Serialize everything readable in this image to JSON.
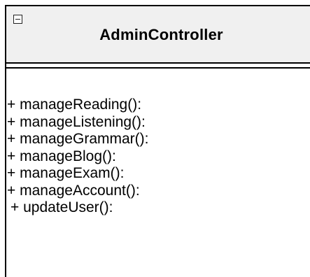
{
  "class": {
    "name": "AdminController",
    "collapse_icon": "minus-box-icon",
    "operations": [
      "+ manageReading():",
      "+ manageListening():",
      "+ manageGrammar():",
      "+ manageBlog():",
      "+ manageExam():",
      "+ manageAccount():",
      "+ updateUser():"
    ]
  }
}
